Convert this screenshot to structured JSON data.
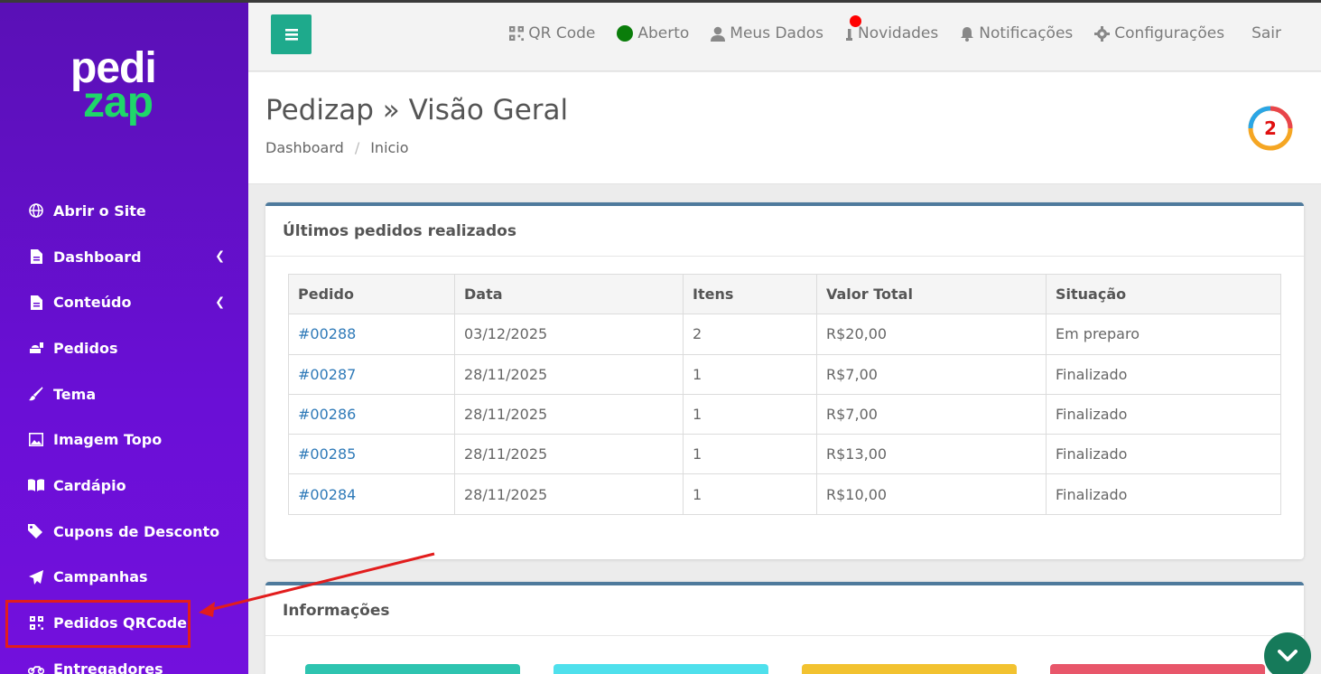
{
  "logo": {
    "line1": "pedi",
    "line2": "zap"
  },
  "sidebar": {
    "items": [
      {
        "label": "Abrir o Site",
        "icon": "globe-icon"
      },
      {
        "label": "Dashboard",
        "icon": "document-icon",
        "chevron": true
      },
      {
        "label": "Conteúdo",
        "icon": "document-icon",
        "chevron": true
      },
      {
        "label": "Pedidos",
        "icon": "orders-icon"
      },
      {
        "label": "Tema",
        "icon": "brush-icon"
      },
      {
        "label": "Imagem Topo",
        "icon": "image-icon"
      },
      {
        "label": "Cardápio",
        "icon": "book-icon"
      },
      {
        "label": "Cupons de Desconto",
        "icon": "tags-icon"
      },
      {
        "label": "Campanhas",
        "icon": "paper-plane-icon"
      },
      {
        "label": "Pedidos QRCode",
        "icon": "qrcode-icon"
      },
      {
        "label": "Entregadores",
        "icon": "motorcycle-icon"
      }
    ]
  },
  "topnav": {
    "qr": "QR Code",
    "status": "Aberto",
    "profile": "Meus Dados",
    "news": "Novidades",
    "notifications": "Notificações",
    "settings": "Configurações",
    "logout": "Sair"
  },
  "header": {
    "title": "Pedizap » Visão Geral",
    "breadcrumb": [
      "Dashboard",
      "Inicio"
    ],
    "badge_count": "2"
  },
  "orders_panel": {
    "title": "Últimos pedidos realizados",
    "columns": [
      "Pedido",
      "Data",
      "Itens",
      "Valor Total",
      "Situação"
    ],
    "rows": [
      [
        "#00288",
        "03/12/2025",
        "2",
        "R$20,00",
        "Em preparo"
      ],
      [
        "#00287",
        "28/11/2025",
        "1",
        "R$7,00",
        "Finalizado"
      ],
      [
        "#00286",
        "28/11/2025",
        "1",
        "R$7,00",
        "Finalizado"
      ],
      [
        "#00285",
        "28/11/2025",
        "1",
        "R$13,00",
        "Finalizado"
      ],
      [
        "#00284",
        "28/11/2025",
        "1",
        "R$10,00",
        "Finalizado"
      ]
    ]
  },
  "info_panel": {
    "title": "Informações"
  },
  "colors": {
    "sidebar_top": "#5a10b6",
    "sidebar_bottom": "#7310dd",
    "accent_green": "#1eaa8c",
    "link": "#2f7ab8",
    "panel_border": "#4e7a9c",
    "tiles": [
      "#2ec4b0",
      "#4fe0ec",
      "#f2c230",
      "#e8566a"
    ]
  }
}
